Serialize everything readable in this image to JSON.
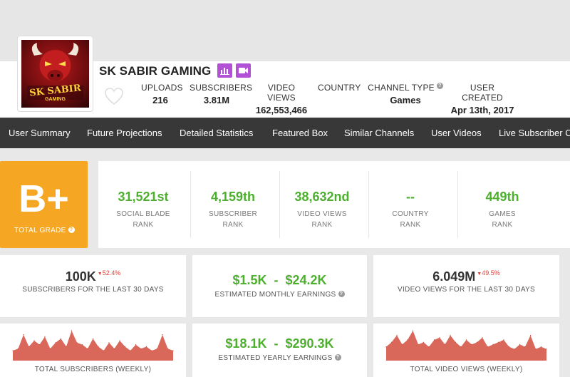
{
  "channel": {
    "name": "SK SABIR GAMING",
    "avatar_text": "SK SABIR",
    "avatar_subtext": "GAMING",
    "icons": [
      "bar-chart-icon",
      "video-camera-icon",
      "heart-icon"
    ]
  },
  "header_stats": [
    {
      "label": "UPLOADS",
      "value": "216"
    },
    {
      "label": "SUBSCRIBERS",
      "value": "3.81M"
    },
    {
      "label": "VIDEO VIEWS",
      "value": "162,553,466"
    },
    {
      "label": "COUNTRY",
      "value": ""
    },
    {
      "label": "CHANNEL TYPE",
      "value": "Games",
      "help": "?"
    },
    {
      "label": "USER CREATED",
      "value": "Apr 13th, 2017"
    }
  ],
  "nav": [
    "User Summary",
    "Future Projections",
    "Detailed Statistics",
    "Featured Box",
    "Similar Channels",
    "User Videos",
    "Live Subscriber Co"
  ],
  "grade": {
    "letter": "B+",
    "label": "TOTAL GRADE",
    "help": "?"
  },
  "ranks": [
    {
      "value": "31,521st",
      "line1": "SOCIAL BLADE",
      "line2": "RANK"
    },
    {
      "value": "4,159th",
      "line1": "SUBSCRIBER",
      "line2": "RANK"
    },
    {
      "value": "38,632nd",
      "line1": "VIDEO VIEWS",
      "line2": "RANK"
    },
    {
      "value": "--",
      "line1": "COUNTRY",
      "line2": "RANK"
    },
    {
      "value": "449th",
      "line1": "GAMES",
      "line2": "RANK"
    }
  ],
  "cards": {
    "subs30": {
      "value": "100K",
      "delta": "52.4%",
      "label": "SUBSCRIBERS FOR THE LAST 30 DAYS"
    },
    "monthly": {
      "low": "$1.5K",
      "sep": "-",
      "high": "$24.2K",
      "label": "ESTIMATED MONTHLY EARNINGS",
      "help": "?"
    },
    "views30": {
      "value": "6.049M",
      "delta": "49.5%",
      "label": "VIDEO VIEWS FOR THE LAST 30 DAYS"
    },
    "subs_weekly": {
      "label": "TOTAL SUBSCRIBERS (WEEKLY)"
    },
    "yearly": {
      "low": "$18.1K",
      "sep": "-",
      "high": "$290.3K",
      "label": "ESTIMATED YEARLY EARNINGS",
      "help": "?"
    },
    "views_weekly": {
      "label": "TOTAL VIDEO VIEWS (WEEKLY)"
    }
  },
  "colors": {
    "green": "#4caf2e",
    "grade_orange": "#f5a623",
    "nav_bg": "#383838",
    "badge_purple": "#b351d6",
    "delta_red": "#e0413a",
    "sparkline_fill": "#d9685a"
  },
  "chart_data": [
    {
      "type": "area",
      "title": "TOTAL SUBSCRIBERS (WEEKLY)",
      "values": [
        10,
        12,
        26,
        14,
        20,
        16,
        24,
        12,
        18,
        22,
        14,
        30,
        18,
        16,
        12,
        22,
        14,
        10,
        18,
        12,
        20,
        14,
        10,
        16,
        12,
        14,
        10,
        12,
        26,
        12,
        10
      ]
    },
    {
      "type": "area",
      "title": "TOTAL VIDEO VIEWS (WEEKLY)",
      "values": [
        12,
        16,
        22,
        14,
        18,
        26,
        14,
        16,
        12,
        18,
        20,
        14,
        22,
        16,
        12,
        18,
        14,
        16,
        20,
        12,
        14,
        16,
        18,
        12,
        10,
        14,
        12,
        22,
        10,
        12,
        10
      ]
    }
  ]
}
